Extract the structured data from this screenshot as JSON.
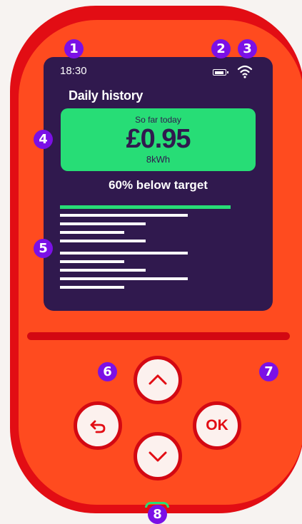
{
  "status_bar": {
    "time": "18:30"
  },
  "screen": {
    "title": "Daily history",
    "cost_card": {
      "label": "So far today",
      "value": "£0.95",
      "energy": "8kWh"
    },
    "target_text": "60% below target"
  },
  "buttons": {
    "ok_label": "OK"
  },
  "badges": [
    "1",
    "2",
    "3",
    "4",
    "5",
    "6",
    "7",
    "8"
  ],
  "colors": {
    "device_outer": "#e20d14",
    "device_face": "#ff4b1f",
    "screen_bg": "#30194e",
    "accent_green": "#27dd76",
    "badge_purple": "#7b10e6"
  }
}
